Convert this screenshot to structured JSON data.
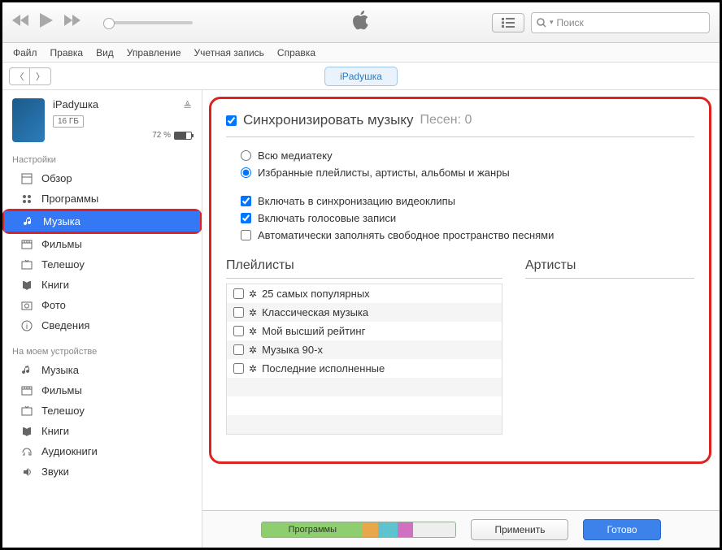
{
  "window": {
    "minimize": "—",
    "maximize": "▢",
    "close": "✕"
  },
  "search": {
    "placeholder": "Поиск"
  },
  "menu": [
    "Файл",
    "Правка",
    "Вид",
    "Управление",
    "Учетная запись",
    "Справка"
  ],
  "devicePill": "iPadушка",
  "device": {
    "name": "iPadушка",
    "capacity": "16 ГБ",
    "batteryPct": "72 %"
  },
  "sidebar": {
    "settingsHeading": "Настройки",
    "settings": [
      {
        "label": "Обзор",
        "icon": "overview",
        "active": false
      },
      {
        "label": "Программы",
        "icon": "apps",
        "active": false
      },
      {
        "label": "Музыка",
        "icon": "music",
        "active": true
      },
      {
        "label": "Фильмы",
        "icon": "movies",
        "active": false
      },
      {
        "label": "Телешоу",
        "icon": "tv",
        "active": false
      },
      {
        "label": "Книги",
        "icon": "books",
        "active": false
      },
      {
        "label": "Фото",
        "icon": "photos",
        "active": false
      },
      {
        "label": "Сведения",
        "icon": "info",
        "active": false
      }
    ],
    "deviceHeading": "На моем устройстве",
    "onDevice": [
      {
        "label": "Музыка",
        "icon": "music"
      },
      {
        "label": "Фильмы",
        "icon": "movies"
      },
      {
        "label": "Телешоу",
        "icon": "tv"
      },
      {
        "label": "Книги",
        "icon": "books"
      },
      {
        "label": "Аудиокниги",
        "icon": "audiobooks"
      },
      {
        "label": "Звуки",
        "icon": "tones"
      }
    ]
  },
  "sync": {
    "title": "Синхронизировать музыку",
    "songCount": "Песен: 0",
    "radio": {
      "all": "Всю медиатеку",
      "selected": "Избранные плейлисты, артисты, альбомы и жанры"
    },
    "checks": {
      "videos": "Включать в синхронизацию видеоклипы",
      "voice": "Включать голосовые записи",
      "autofill": "Автоматически заполнять свободное пространство песнями"
    },
    "playlistsTitle": "Плейлисты",
    "artistsTitle": "Артисты",
    "playlists": [
      "25 самых популярных",
      "Классическая музыка",
      "Мой высший рейтинг",
      "Музыка 90-х",
      "Последние исполненные"
    ]
  },
  "bottom": {
    "capacityLabel": "Программы",
    "apply": "Применить",
    "done": "Готово"
  }
}
